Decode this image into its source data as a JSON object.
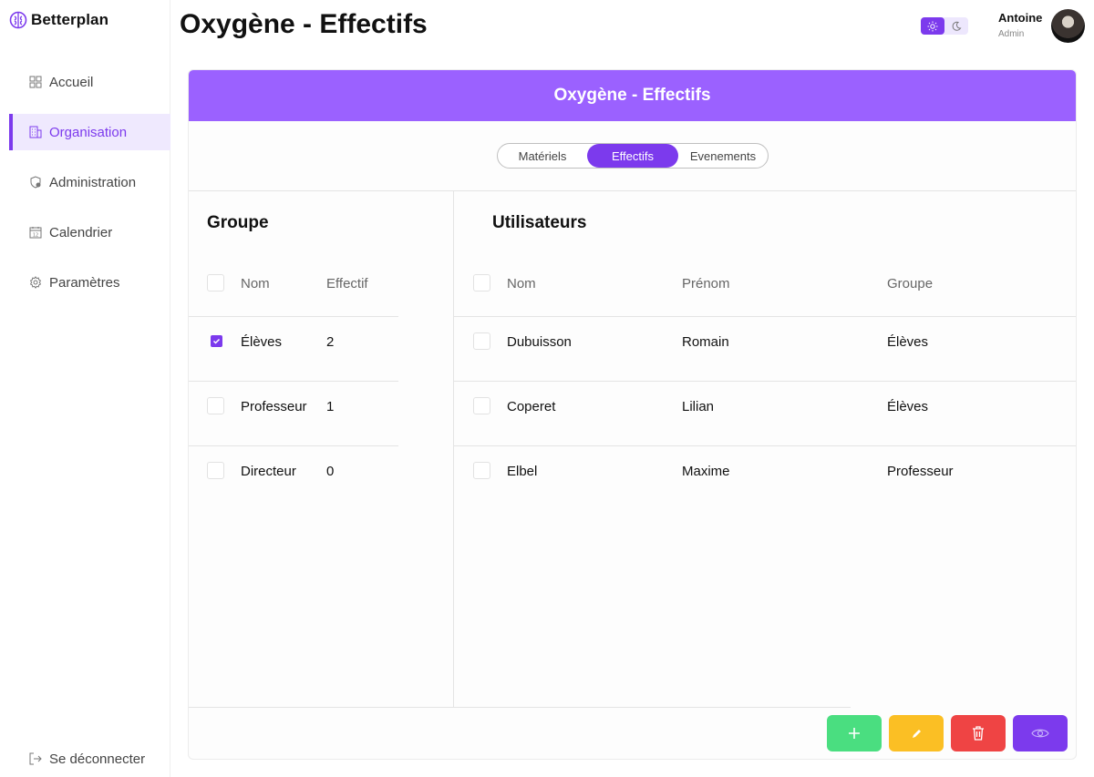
{
  "brand": {
    "name": "Betterplan"
  },
  "sidebar": {
    "items": [
      {
        "label": "Accueil",
        "icon": "grid-icon"
      },
      {
        "label": "Organisation",
        "icon": "building-icon",
        "active": true
      },
      {
        "label": "Administration",
        "icon": "shield-user-icon"
      },
      {
        "label": "Calendrier",
        "icon": "calendar-icon"
      },
      {
        "label": "Paramètres",
        "icon": "gear-icon"
      }
    ],
    "logout_label": "Se déconnecter"
  },
  "header": {
    "title": "Oxygène - Effectifs",
    "user": {
      "name": "Antoine",
      "role": "Admin"
    },
    "theme": "light"
  },
  "card": {
    "title": "Oxygène - Effectifs",
    "tabs": [
      {
        "label": "Matériels"
      },
      {
        "label": "Effectifs",
        "active": true
      },
      {
        "label": "Evenements"
      }
    ]
  },
  "groups": {
    "title": "Groupe",
    "columns": [
      "Nom",
      "Effectif"
    ],
    "rows": [
      {
        "nom": "Élèves",
        "effectif": "2",
        "checked": true
      },
      {
        "nom": "Professeur",
        "effectif": "1",
        "checked": false
      },
      {
        "nom": "Directeur",
        "effectif": "0",
        "checked": false
      }
    ]
  },
  "users": {
    "title": "Utilisateurs",
    "columns": [
      "Nom",
      "Prénom",
      "Groupe"
    ],
    "rows": [
      {
        "nom": "Dubuisson",
        "prenom": "Romain",
        "groupe": "Élèves"
      },
      {
        "nom": "Coperet",
        "prenom": "Lilian",
        "groupe": "Élèves"
      },
      {
        "nom": "Elbel",
        "prenom": "Maxime",
        "groupe": "Professeur"
      }
    ]
  },
  "actions": [
    {
      "name": "add",
      "icon": "plus-icon",
      "color": "#4ade80"
    },
    {
      "name": "edit",
      "icon": "pencil-icon",
      "color": "#fbbf24"
    },
    {
      "name": "delete",
      "icon": "trash-icon",
      "color": "#ef4444"
    },
    {
      "name": "view",
      "icon": "eye-icon",
      "color": "#7c3aed"
    }
  ],
  "colors": {
    "accent": "#7c3aed",
    "header": "#9b61ff"
  }
}
